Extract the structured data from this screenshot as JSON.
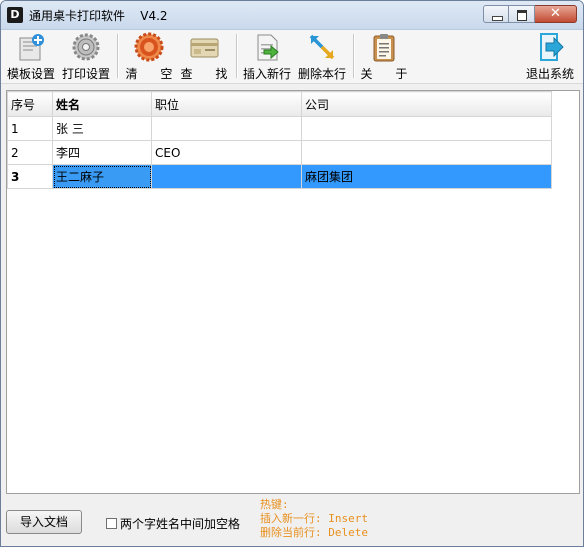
{
  "window": {
    "title": "通用桌卡打印软件    V4.2",
    "logo": "D"
  },
  "toolbar": {
    "template": "模板设置",
    "print": "打印设置",
    "clear": "清      空",
    "find": "查      找",
    "insert": "插入新行",
    "delete": "删除本行",
    "about": "关      于",
    "exit": "退出系统"
  },
  "table": {
    "headers": [
      "序号",
      "姓名",
      "职位",
      "公司"
    ],
    "rows": [
      [
        "1",
        "张  三",
        "",
        ""
      ],
      [
        "2",
        "李四",
        "CEO",
        ""
      ],
      [
        "3",
        "王二麻子",
        "",
        "麻团集团"
      ]
    ]
  },
  "footer": {
    "import": "导入文档",
    "checkbox": "两个字姓名中间加空格",
    "hot_title": "热键:",
    "hot_insert": "插入新一行: Insert",
    "hot_delete": "删除当前行: Delete"
  },
  "colors": {
    "selection": "#3399ff",
    "hotkeys": "#e8901e",
    "clear_icon": "#d9531e",
    "exit_icon": "#2aa7d8"
  }
}
